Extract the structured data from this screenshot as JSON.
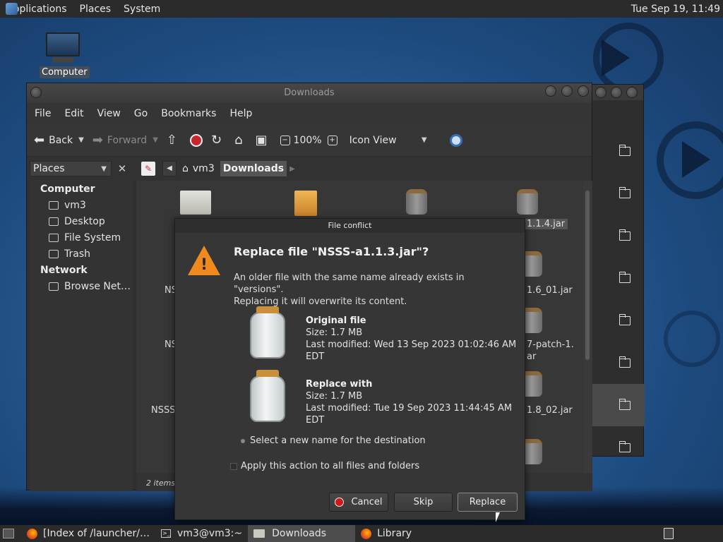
{
  "top_panel": {
    "menus": [
      "Applications",
      "Places",
      "System"
    ],
    "clock": "Tue Sep 19, 11:49"
  },
  "desktop": {
    "computer_label": "Computer"
  },
  "window": {
    "title": "Downloads",
    "menu": [
      "File",
      "Edit",
      "View",
      "Go",
      "Bookmarks",
      "Help"
    ],
    "toolbar": {
      "back": "Back",
      "forward": "Forward",
      "zoom": "100%",
      "view_mode": "Icon View"
    },
    "places_selector": "Places",
    "breadcrumbs": [
      "vm3",
      "Downloads"
    ],
    "sidebar": {
      "computer_header": "Computer",
      "computer_items": [
        "vm3",
        "Desktop",
        "File System",
        "Trash"
      ],
      "network_header": "Network",
      "network_items": [
        "Browse Net…"
      ]
    },
    "files": {
      "top_label": "1.1.4.jar",
      "left_labels": [
        "NS",
        "NS",
        "NSSS-"
      ],
      "right_labels": [
        "1.6_01.jar",
        "7-patch-1.",
        "ar",
        "1.8_02.jar"
      ]
    },
    "status": "2 items s"
  },
  "dialog": {
    "title": "File conflict",
    "heading": "Replace file \"NSSS-a1.1.3.jar\"?",
    "message_line1": "An older file with the same name already exists in \"versions\".",
    "message_line2": "Replacing it will overwrite its content.",
    "original": {
      "title": "Original file",
      "size": "Size: 1.7 MB",
      "modified": "Last modified: Wed 13 Sep 2023 01:02:46 AM EDT"
    },
    "replacement": {
      "title": "Replace with",
      "size": "Size: 1.7 MB",
      "modified": "Last modified: Tue 19 Sep 2023 11:44:45 AM EDT"
    },
    "rename_option": "Select a new name for the destination",
    "apply_all": "Apply this action to all files and folders",
    "buttons": {
      "cancel": "Cancel",
      "skip": "Skip",
      "replace": "Replace"
    }
  },
  "taskbar": {
    "tasks": [
      "[Index of /launcher/…",
      "vm3@vm3:~",
      "Downloads",
      "Library"
    ]
  }
}
